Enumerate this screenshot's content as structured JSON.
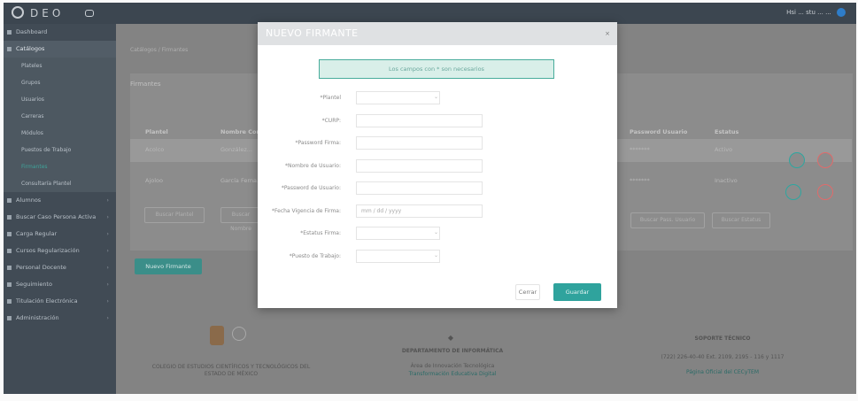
{
  "app": {
    "logo": "DEO",
    "user_text": "Hsi ... stu ... ..."
  },
  "sidebar": {
    "items": [
      {
        "label": "Dashboard",
        "kind": "top"
      },
      {
        "label": "Catálogos",
        "kind": "active"
      },
      {
        "label": "Plateles",
        "kind": "sub"
      },
      {
        "label": "Grupos",
        "kind": "sub"
      },
      {
        "label": "Usuarios",
        "kind": "sub"
      },
      {
        "label": "Carreras",
        "kind": "sub"
      },
      {
        "label": "Módulos",
        "kind": "sub"
      },
      {
        "label": "Puestos de Trabajo",
        "kind": "sub"
      },
      {
        "label": "Firmantes",
        "kind": "sub-current"
      },
      {
        "label": "Consultaría Plantel",
        "kind": "sub"
      },
      {
        "label": "Alumnos",
        "kind": "top"
      },
      {
        "label": "Buscar Caso Persona Activa",
        "kind": "top"
      },
      {
        "label": "Carga Regular",
        "kind": "top"
      },
      {
        "label": "Cursos Regularización",
        "kind": "top"
      },
      {
        "label": "Personal Docente",
        "kind": "top"
      },
      {
        "label": "Seguimiento",
        "kind": "top"
      },
      {
        "label": "Titulación Electrónica",
        "kind": "top"
      },
      {
        "label": "Administración",
        "kind": "top"
      }
    ]
  },
  "breadcrumb": "Catálogos / Firmantes",
  "page_title": "Firmantes",
  "table": {
    "headers": [
      "Plantel",
      "Nombre Com...",
      "Password Usuario",
      "Estatus"
    ],
    "rows": [
      {
        "plantel": "Acolco",
        "nombre": "González...",
        "password": "*******",
        "status": "Activo"
      },
      {
        "plantel": "Ajoloo",
        "nombre": "García Ferna...",
        "password": "*******",
        "status": "Inactivo"
      }
    ],
    "filter_buttons": [
      "Buscar Plantel",
      "Buscar Nombre",
      "Buscar Pass. Usuario",
      "Buscar Estatus"
    ],
    "new_button": "Nuevo Firmante"
  },
  "footer": {
    "left": "COLEGIO DE ESTUDIOS CIENTÍFICOS Y TECNOLÓGICOS DEL ESTADO DE MÉXICO",
    "center_title": "DEPARTAMENTO DE INFORMÁTICA",
    "center_sub": "Área de Innovación Tecnológica",
    "center_link": "Transformación Educativa Digital",
    "right_title": "SOPORTE TÉCNICO",
    "right_sub": "(722) 226-40-40 Ext. 2109, 2195 - 116 y 1117",
    "right_link": "Página Oficial del CECyTEM"
  },
  "modal": {
    "title": "NUEVO FIRMANTE",
    "alert": "Los campos con * son necesarios",
    "fields": [
      {
        "label": "*Plantel",
        "type": "select",
        "value": ""
      },
      {
        "label": "*CURP:",
        "type": "text",
        "value": ""
      },
      {
        "label": "*Password Firma:",
        "type": "text",
        "value": ""
      },
      {
        "label": "*Nombre de Usuario:",
        "type": "text",
        "value": ""
      },
      {
        "label": "*Password de Usuario:",
        "type": "text",
        "value": ""
      },
      {
        "label": "*Fecha Vigencia de Firma:",
        "type": "text",
        "value": "",
        "placeholder": "mm / dd / yyyy"
      },
      {
        "label": "*Estatus Firma:",
        "type": "select",
        "value": ""
      },
      {
        "label": "*Puesto de Trabajo:",
        "type": "select",
        "value": ""
      }
    ],
    "cancel_label": "Cerrar",
    "save_label": "Guardar"
  },
  "colors": {
    "accent": "#2fa39d",
    "sidebar": "#414b55",
    "overlay": "#7b7b7b"
  }
}
